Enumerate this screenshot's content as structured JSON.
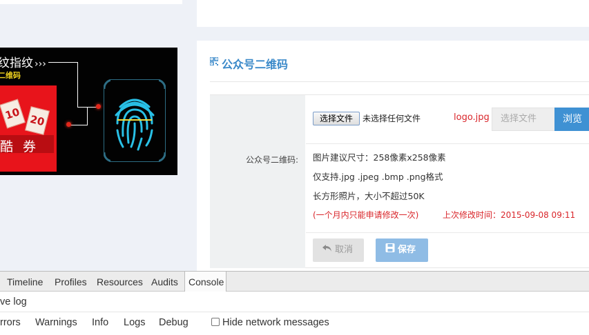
{
  "banner": {
    "title": "纹指纹",
    "arrows": "›››",
    "subtitle": "二维码",
    "coupon_numbers": [
      "10",
      "20"
    ],
    "coupon_text": "酷 券"
  },
  "section": {
    "title": "公众号二维码"
  },
  "form": {
    "label": "公众号二维码:",
    "file_button": "选择文件",
    "file_status": "未选择任何文件",
    "logo_filename": "logo.jpg",
    "file_input_placeholder": "选择文件",
    "browse_label": "浏览",
    "info_size": "图片建议尺寸：258像素x258像素",
    "info_formats": "仅支持.jpg .jpeg .bmp .png格式",
    "info_limit": "长方形照片，大小不超过50K",
    "info_monthly": "(一个月内只能申请修改一次)",
    "info_last_modified": "上次修改时间：2015-09-08 09:11",
    "cancel_label": "取消",
    "save_label": "保存"
  },
  "devtools": {
    "tabs": [
      "Timeline",
      "Profiles",
      "Resources",
      "Audits",
      "Console"
    ],
    "active_tab": "Console",
    "preserve_log": "ve log",
    "filters": [
      "rrors",
      "Warnings",
      "Info",
      "Logs",
      "Debug"
    ],
    "hide_network": "Hide network messages"
  },
  "colors": {
    "accent": "#3f91d3",
    "title_blue": "#3a89c9",
    "warning_red": "#d9252a",
    "save_disabled": "#8fbce5"
  }
}
